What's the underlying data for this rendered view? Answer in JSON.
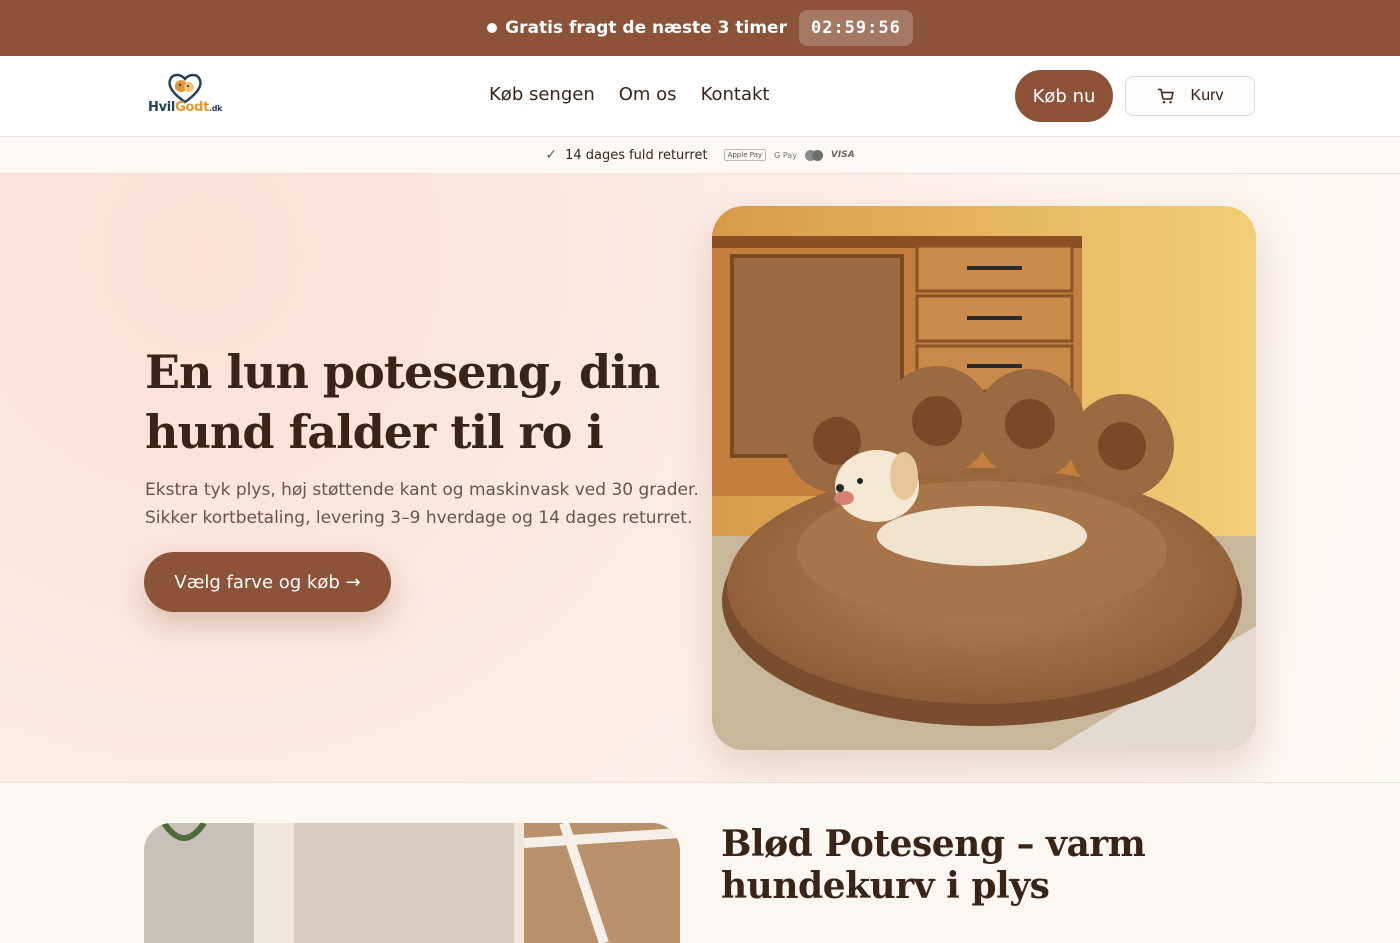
{
  "announcement": {
    "message": "Gratis fragt de næste 3 timer",
    "timer": "02:59:56"
  },
  "header": {
    "logo": {
      "part1": "Hvil",
      "part2": "Godt",
      "tld": ".dk"
    },
    "nav": [
      "Køb sengen",
      "Om os",
      "Kontakt"
    ],
    "buy_label": "Køb nu",
    "cart_label": "Kurv"
  },
  "trust": {
    "returns": "14 dages fuld returret",
    "payment_methods": [
      "Apple Pay",
      "G Pay",
      "Mastercard",
      "VISA"
    ]
  },
  "hero": {
    "title": "En lun poteseng, din hund falder til ro i",
    "text": "Ekstra tyk plys, høj støttende kant og maskinvask ved 30 grader. Sikker kortbetaling, levering 3–9 hverdage og 14 dages returret.",
    "cta": "Vælg farve og køb →"
  },
  "section2": {
    "title": "Blød Poteseng – varm hundekurv i plys"
  },
  "colors": {
    "brand": "#8c5338",
    "text": "#3a2418",
    "background": "#fcf6f2"
  }
}
